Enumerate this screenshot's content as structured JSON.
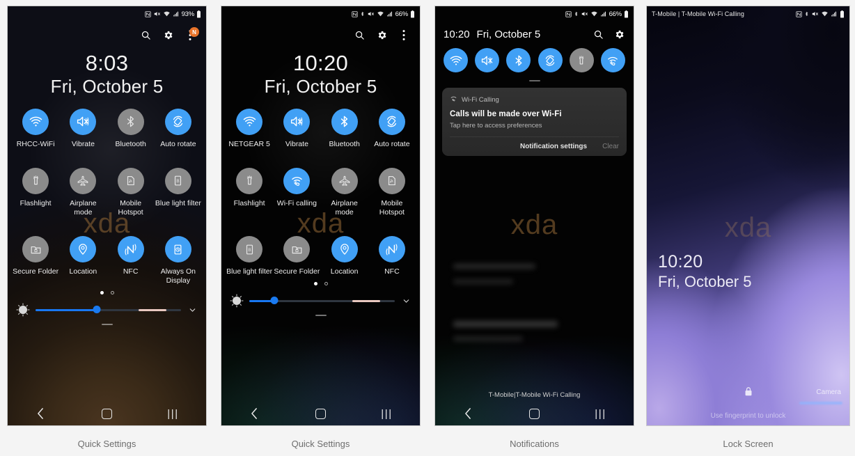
{
  "panels": [
    {
      "caption": "Quick Settings",
      "statusbar": {
        "left": "",
        "battery": "93%",
        "icons": [
          "nfc-icon",
          "mute-icon",
          "wifi-icon",
          "signal-icon",
          "battery-icon"
        ]
      },
      "header": {
        "search": "search-icon",
        "settings": "gear-icon",
        "more": "more-icon",
        "badge": "N"
      },
      "clock": {
        "time": "8:03",
        "date": "Fri, October 5"
      },
      "watermark": "xda",
      "tiles": [
        {
          "label": "RHCC-WiFi",
          "state": "on",
          "icon": "wifi-icon"
        },
        {
          "label": "Vibrate",
          "state": "on",
          "icon": "vibrate-icon"
        },
        {
          "label": "Bluetooth",
          "state": "off",
          "icon": "bluetooth-icon"
        },
        {
          "label": "Auto rotate",
          "state": "on",
          "icon": "autorotate-icon"
        },
        {
          "label": "Flashlight",
          "state": "off",
          "icon": "flashlight-icon"
        },
        {
          "label": "Airplane mode",
          "state": "off",
          "icon": "airplane-icon"
        },
        {
          "label": "Mobile Hotspot",
          "state": "off",
          "icon": "hotspot-icon"
        },
        {
          "label": "Blue light filter",
          "state": "off",
          "icon": "bluelight-icon"
        },
        {
          "label": "Secure Folder",
          "state": "off",
          "icon": "securefolder-icon"
        },
        {
          "label": "Location",
          "state": "on",
          "icon": "location-icon"
        },
        {
          "label": "NFC",
          "state": "on",
          "icon": "nfc-icon"
        },
        {
          "label": "Always On Display",
          "state": "on",
          "icon": "aod-icon"
        }
      ],
      "pager": {
        "pages": 2,
        "active": 1
      },
      "brightness": {
        "value": 42,
        "auto_marker": true
      },
      "navbar": {
        "back": "back-icon",
        "home": "home-icon",
        "recents": "recents-icon"
      }
    },
    {
      "caption": "Quick Settings",
      "statusbar": {
        "left": "",
        "battery": "66%",
        "icons": [
          "nfc-icon",
          "bluetooth-icon",
          "mute-icon",
          "wifi-icon",
          "signal-icon",
          "battery-icon"
        ]
      },
      "header": {
        "search": "search-icon",
        "settings": "gear-icon",
        "more": "more-icon"
      },
      "clock": {
        "time": "10:20",
        "date": "Fri, October 5"
      },
      "watermark": "xda",
      "tiles": [
        {
          "label": "NETGEAR 5",
          "state": "on",
          "icon": "wifi-icon"
        },
        {
          "label": "Vibrate",
          "state": "on",
          "icon": "vibrate-icon"
        },
        {
          "label": "Bluetooth",
          "state": "on",
          "icon": "bluetooth-icon"
        },
        {
          "label": "Auto rotate",
          "state": "on",
          "icon": "autorotate-icon"
        },
        {
          "label": "Flashlight",
          "state": "off",
          "icon": "flashlight-icon"
        },
        {
          "label": "Wi-Fi calling",
          "state": "on",
          "icon": "wificalling-icon"
        },
        {
          "label": "Airplane mode",
          "state": "off",
          "icon": "airplane-icon"
        },
        {
          "label": "Mobile Hotspot",
          "state": "off",
          "icon": "hotspot-icon"
        },
        {
          "label": "Blue light filter",
          "state": "off",
          "icon": "bluelight-icon"
        },
        {
          "label": "Secure Folder",
          "state": "off",
          "icon": "securefolder-icon"
        },
        {
          "label": "Location",
          "state": "on",
          "icon": "location-icon"
        },
        {
          "label": "NFC",
          "state": "on",
          "icon": "nfc-icon"
        }
      ],
      "pager": {
        "pages": 2,
        "active": 1
      },
      "brightness": {
        "value": 24,
        "auto_marker": true
      },
      "navbar": {
        "back": "back-icon",
        "home": "home-icon",
        "recents": "recents-icon"
      }
    },
    {
      "caption": "Notifications",
      "statusbar": {
        "left": "",
        "battery": "66%",
        "icons": [
          "nfc-icon",
          "bluetooth-icon",
          "mute-icon",
          "wifi-icon",
          "signal-icon",
          "battery-icon"
        ]
      },
      "header": {
        "time": "10:20",
        "date": "Fri, October 5",
        "search": "search-icon",
        "settings": "gear-icon"
      },
      "quick_strip": [
        {
          "state": "on",
          "icon": "wifi-icon"
        },
        {
          "state": "on",
          "icon": "vibrate-icon"
        },
        {
          "state": "on",
          "icon": "bluetooth-icon"
        },
        {
          "state": "on",
          "icon": "autorotate-icon"
        },
        {
          "state": "off",
          "icon": "flashlight-icon"
        },
        {
          "state": "on",
          "icon": "wificalling-icon"
        }
      ],
      "notification": {
        "app": "Wi-Fi Calling",
        "app_icon": "wificalling-icon",
        "title": "Calls will be made over Wi-Fi",
        "body": "Tap here to access preferences",
        "action_settings": "Notification settings",
        "action_clear": "Clear"
      },
      "watermark": "xda",
      "carrier": "T-Mobile|T-Mobile Wi-Fi Calling",
      "navbar": {
        "back": "back-icon",
        "home": "home-icon",
        "recents": "recents-icon"
      }
    },
    {
      "caption": "Lock Screen",
      "statusbar": {
        "left": "T-Mobile | T-Mobile Wi-Fi Calling",
        "battery": "",
        "icons": [
          "nfc-icon",
          "bluetooth-icon",
          "mute-icon",
          "wifi-icon",
          "signal-icon",
          "battery-icon"
        ]
      },
      "watermark": "xda",
      "clock": {
        "time": "10:20",
        "date": "Fri, October 5"
      },
      "lock_icon": "lock-icon",
      "hint": "Use fingerprint to unlock",
      "camera": "Camera"
    }
  ],
  "theme": {
    "accent_on": "#41a0f5",
    "tile_off": "#8b8b8b",
    "slider_fill": "#1877f2",
    "badge": "#e8732a",
    "caption_color": "#6d6d6d"
  }
}
